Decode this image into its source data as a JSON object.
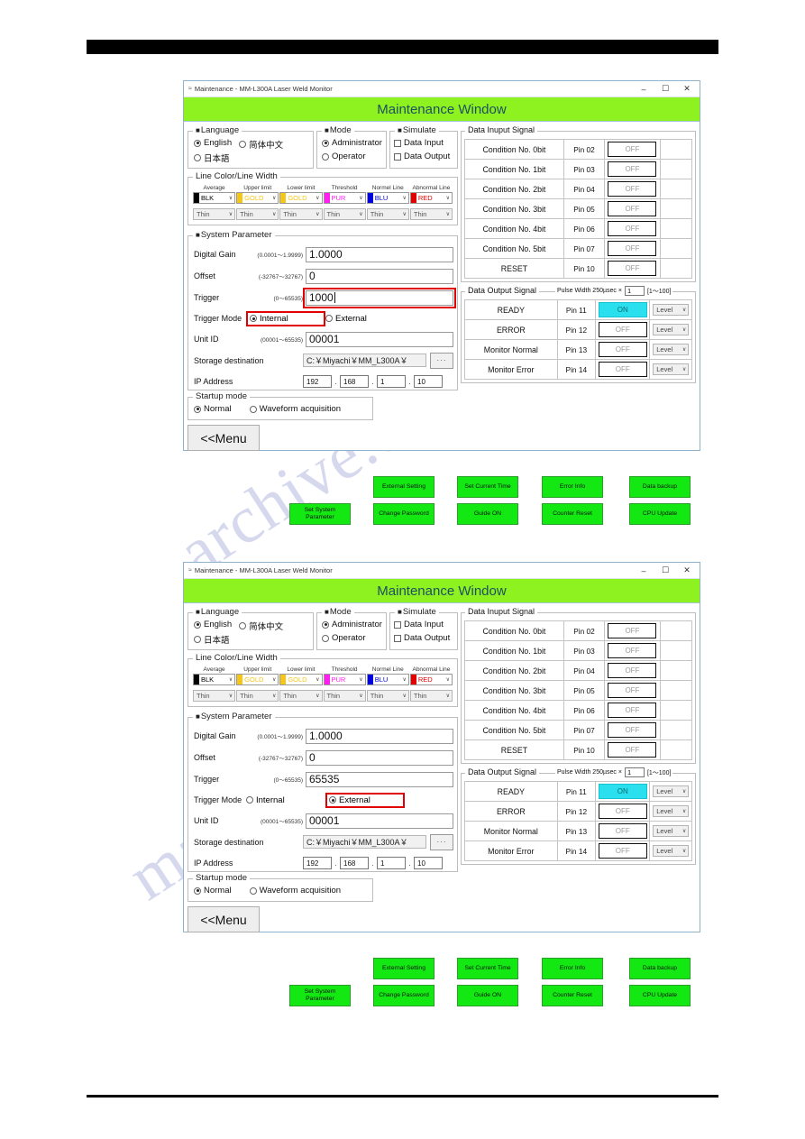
{
  "window": {
    "titlebar": {
      "icon": "app-icon",
      "title": "Maintenance - MM-L300A Laser Weld Monitor",
      "minimize": "–",
      "maximize": "☐",
      "close": "✕"
    },
    "header_title": "Maintenance Window",
    "language": {
      "legend": "Language",
      "options": [
        {
          "label": "English",
          "selected": true
        },
        {
          "label": "简体中文",
          "selected": false
        },
        {
          "label": "日本語",
          "selected": false
        }
      ]
    },
    "mode": {
      "legend": "Mode",
      "options": [
        {
          "label": "Administrator",
          "selected": true
        },
        {
          "label": "Operator",
          "selected": false
        }
      ]
    },
    "simulate": {
      "legend": "Simulate",
      "options": [
        {
          "label": "Data Input",
          "checked": false
        },
        {
          "label": "Data Output",
          "checked": false
        }
      ]
    },
    "line_color": {
      "legend": "Line Color/Line Width",
      "columns": [
        {
          "header": "Average",
          "color_label": "BLK",
          "swatch": "#000000",
          "text_color": "#000000",
          "width": "Thin"
        },
        {
          "header": "Upper limit",
          "color_label": "GOLD",
          "swatch": "#f5c518",
          "text_color": "#f5c518",
          "width": "Thin"
        },
        {
          "header": "Lower limit",
          "color_label": "GOLD",
          "swatch": "#f5c518",
          "text_color": "#f5c518",
          "width": "Thin"
        },
        {
          "header": "Threshold",
          "color_label": "PUR",
          "swatch": "#ff20f0",
          "text_color": "#ff20f0",
          "width": "Thin"
        },
        {
          "header": "Normel Line",
          "color_label": "BLU",
          "swatch": "#0000dd",
          "text_color": "#0000dd",
          "width": "Thin"
        },
        {
          "header": "Abnormal Line",
          "color_label": "RED",
          "swatch": "#e00000",
          "text_color": "#e00000",
          "width": "Thin"
        }
      ]
    },
    "system_parameter": {
      "legend": "System Parameter",
      "digital_gain": {
        "label": "Digital Gain",
        "range": "(0.0001～1.9999)",
        "value": "1.0000"
      },
      "offset": {
        "label": "Offset",
        "range": "(-32767～32767)",
        "value": "0"
      },
      "trigger": {
        "label": "Trigger",
        "range": "(0～65535)"
      },
      "trigger_mode": {
        "label": "Trigger Mode",
        "internal_label": "Internal",
        "external_label": "External"
      },
      "unit_id": {
        "label": "Unit ID",
        "range": "(00001～65535)",
        "value": "00001"
      },
      "storage": {
        "label": "Storage destination",
        "value": "C:￥Miyachi￥MM_L300A￥",
        "browse_label": "···"
      },
      "ip_address": {
        "label": "IP Address",
        "octets": [
          "192",
          "168",
          "1",
          "10"
        ],
        "separator": "."
      }
    },
    "startup_mode": {
      "legend": "Startup mode",
      "options": [
        {
          "label": "Normal",
          "selected": true
        },
        {
          "label": "Waveform acquisition",
          "selected": false
        }
      ]
    },
    "menu_button": "<<Menu",
    "data_input_signal": {
      "legend": "Data Inuput Signal",
      "rows": [
        {
          "name": "Condition No. 0bit",
          "pin": "Pin 02",
          "state": "OFF",
          "on": false
        },
        {
          "name": "Condition No. 1bit",
          "pin": "Pin 03",
          "state": "OFF",
          "on": false
        },
        {
          "name": "Condition No. 2bit",
          "pin": "Pin 04",
          "state": "OFF",
          "on": false
        },
        {
          "name": "Condition No. 3bit",
          "pin": "Pin 05",
          "state": "OFF",
          "on": false
        },
        {
          "name": "Condition No. 4bit",
          "pin": "Pin 06",
          "state": "OFF",
          "on": false
        },
        {
          "name": "Condition No. 5bit",
          "pin": "Pin 07",
          "state": "OFF",
          "on": false
        },
        {
          "name": "RESET",
          "pin": "Pin 10",
          "state": "OFF",
          "on": false
        }
      ]
    },
    "data_output_signal": {
      "legend": "Data Output Signal",
      "pulse_width": {
        "label": "Pulse Width",
        "unit": "250µsec ×",
        "value": "1",
        "range": "[1～100]"
      },
      "rows": [
        {
          "name": "READY",
          "pin": "Pin 11",
          "state": "ON",
          "on": true,
          "level": "Level"
        },
        {
          "name": "ERROR",
          "pin": "Pin 12",
          "state": "OFF",
          "on": false,
          "level": "Level"
        },
        {
          "name": "Monitor Normal",
          "pin": "Pin 13",
          "state": "OFF",
          "on": false,
          "level": "Level"
        },
        {
          "name": "Monitor Error",
          "pin": "Pin 14",
          "state": "OFF",
          "on": false,
          "level": "Level"
        }
      ]
    },
    "action_buttons": {
      "external_setting": "External Setting",
      "set_system_parameter": "Set System Parameter",
      "set_current_time": "Set Current Time",
      "change_password": "Change Password",
      "error_info": "Error Info",
      "guide_on": "Guide ON",
      "data_backup": "Data backup",
      "counter_reset": "Counter Reset",
      "cpu_update": "CPU Update"
    },
    "colors": {
      "header_green": "#8ef221",
      "button_green": "#13e813",
      "on_cyan": "#2ae0ee",
      "highlight_red": "#e00000"
    }
  },
  "screens": [
    {
      "id": "screen-internal",
      "trigger_value": "1000",
      "trigger_highlighted": true,
      "trigger_mode_internal": true,
      "trigger_mode_highlight": "internal",
      "caret": true
    },
    {
      "id": "screen-external",
      "trigger_value": "65535",
      "trigger_highlighted": false,
      "trigger_mode_internal": false,
      "trigger_mode_highlight": "external",
      "caret": false
    }
  ],
  "watermark": {
    "line1": "archive.com",
    "line2": "manualsarchive"
  }
}
